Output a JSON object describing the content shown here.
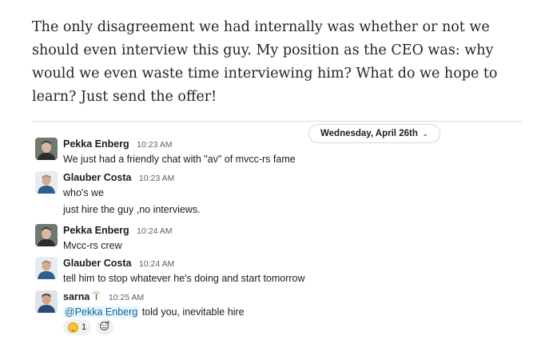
{
  "article": {
    "paragraph": "The only disagreement we had internally was whether or not we should even interview this guy. My position as the CEO was: why would we even waste time interviewing him? What do we hope to learn? Just send the offer!"
  },
  "date_divider": {
    "label": "Wednesday, April 26th",
    "icon": "chevron-down-icon"
  },
  "messages": [
    {
      "author": "Pekka Enberg",
      "time": "10:23 AM",
      "text": "We just had a friendly chat with \"av\" of mvcc-rs fame"
    },
    {
      "author": "Glauber Costa",
      "time": "10:23 AM",
      "text": "who's we",
      "continuation": "just hire the guy ,no interviews."
    },
    {
      "author": "Pekka Enberg",
      "time": "10:24 AM",
      "text": "Mvcc-rs crew"
    },
    {
      "author": "Glauber Costa",
      "time": "10:24 AM",
      "text": "tell him to stop whatever he's doing and start tomorrow"
    },
    {
      "author": "sarna",
      "status_icon": "palm-tree-icon",
      "time": "10:25 AM",
      "mention": "@Pekka Enberg",
      "text": " told you, inevitable hire"
    }
  ],
  "reactions": [
    {
      "emoji": "grinning-face-icon",
      "count": "1"
    }
  ],
  "add_reaction_icon": "add-reaction-icon",
  "colors": {
    "mention_text": "#1264a3",
    "mention_bg": "#e8f5fa",
    "divider": "#dddddd"
  }
}
